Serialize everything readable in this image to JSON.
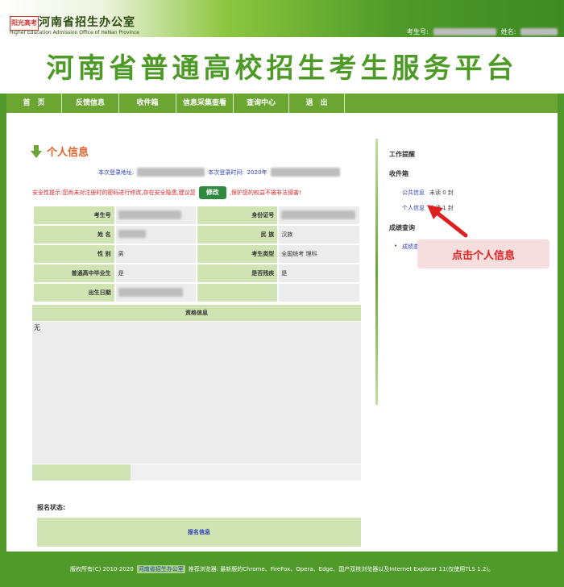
{
  "header": {
    "logo_badge": "阳光高考",
    "org_name": "河南省招生办公室",
    "org_name_en": "Higher Education Admission Office of HeNan Province",
    "candidate_no_label": "考生号:",
    "name_label": "姓名:"
  },
  "banner": {
    "title": "河南省普通高校招生考生服务平台"
  },
  "nav": {
    "items": [
      {
        "label": "首　页"
      },
      {
        "label": "反馈信息"
      },
      {
        "label": "收件箱"
      },
      {
        "label": "信息采集查看"
      },
      {
        "label": "查询中心"
      },
      {
        "label": "退　出"
      }
    ]
  },
  "main": {
    "section_title": "个人信息",
    "login_address_label": "本次登录地址:",
    "login_time_label": "本次登录时间:",
    "login_time_prefix": "2020年",
    "security_prefix": "安全性提示:您尚未对注册时的密码进行修改,存在安全隐患,建议您",
    "modify_button": "修改",
    "security_suffix": ",保护您的权益不被非法侵害!",
    "fields": {
      "candidate_no_label": "考生号",
      "id_no_label": "身份证号",
      "name_label": "姓 名",
      "nation_label": "民 族",
      "nation_value": "汉族",
      "gender_label": "性 别",
      "gender_value": "男",
      "type_label": "考生类型",
      "type_value": "全国统考 理科",
      "grad_label": "普通高中毕业生",
      "grad_value": "是",
      "disability_label": "是否残疾",
      "disability_value": "是",
      "birth_label": "出生日期"
    },
    "school_header": "资格信息",
    "school_value": "无",
    "reg_status_label": "报名状态:",
    "reg_status_link": "报名信息"
  },
  "sidebar": {
    "work_reminder": "工作提醒",
    "inbox": "收件箱",
    "public_notice": "公共信息",
    "public_notice_count": "未读 0 封",
    "personal_notice": "个人信息",
    "personal_notice_count": "未读 1 封",
    "score_query": "成绩查询",
    "score_link": "成绩查询"
  },
  "annotation": {
    "callout_text": "点击个人信息"
  },
  "footer": {
    "copyright": "版权所有(C) 2010-2020",
    "org_link": "河南省招生办公室",
    "browser_text": "推荐浏览器: 最新版的Chrome、FireFox、Opera、Edge、国产双核浏览器以及Internet Explorer 11(仅使用TLS 1.2)。"
  },
  "colors": {
    "brand_green": "#4f9a2a",
    "nav_green": "#6aa631",
    "label_bg": "#cfe3b3",
    "callout_red": "#e02020"
  }
}
